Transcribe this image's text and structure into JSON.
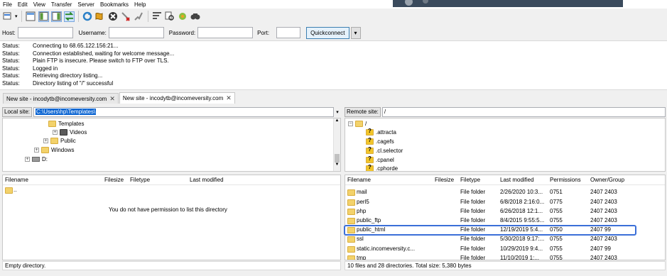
{
  "menu": [
    "File",
    "Edit",
    "View",
    "Transfer",
    "Server",
    "Bookmarks",
    "Help"
  ],
  "quickconnect": {
    "host_label": "Host:",
    "user_label": "Username:",
    "pass_label": "Password:",
    "port_label": "Port:",
    "button": "Quickconnect"
  },
  "log": [
    {
      "k": "Status:",
      "v": "Connecting to 68.65.122.156:21..."
    },
    {
      "k": "Status:",
      "v": "Connection established, waiting for welcome message..."
    },
    {
      "k": "Status:",
      "v": "Plain FTP is insecure. Please switch to FTP over TLS."
    },
    {
      "k": "Status:",
      "v": "Logged in"
    },
    {
      "k": "Status:",
      "v": "Retrieving directory listing..."
    },
    {
      "k": "Status:",
      "v": "Directory listing of \"/\" successful"
    }
  ],
  "tabs": [
    {
      "label": "New site - incodytb@incomeversity.com"
    },
    {
      "label": "New site - incodytb@incomeversity.com"
    }
  ],
  "local": {
    "label": "Local site:",
    "path": "C:\\Users\\hp\\Templates\\",
    "tree": [
      "Templates",
      "Videos",
      "Public",
      "Windows",
      "D:"
    ],
    "cols": [
      "Filename",
      "Filesize",
      "Filetype",
      "Last modified"
    ],
    "rows": [
      ".."
    ],
    "empty_msg": "You do not have permission to list this directory",
    "status": "Empty directory."
  },
  "remote": {
    "label": "Remote site:",
    "path": "/",
    "tree": [
      "/",
      ".attracta",
      ".cagefs",
      ".cl.selector",
      ".cpanel",
      ".cphorde"
    ],
    "cols": [
      "Filename",
      "Filesize",
      "Filetype",
      "Last modified",
      "Permissions",
      "Owner/Group"
    ],
    "rows": [
      {
        "name": "mail",
        "type": "File folder",
        "mod": "2/26/2020 10:3...",
        "perm": "0751",
        "owner": "2407 2403"
      },
      {
        "name": "perl5",
        "type": "File folder",
        "mod": "6/8/2018 2:16:0...",
        "perm": "0775",
        "owner": "2407 2403"
      },
      {
        "name": "php",
        "type": "File folder",
        "mod": "6/26/2018 12:1...",
        "perm": "0755",
        "owner": "2407 2403"
      },
      {
        "name": "public_ftp",
        "type": "File folder",
        "mod": "8/4/2015 9:55:5...",
        "perm": "0755",
        "owner": "2407 2403"
      },
      {
        "name": "public_html",
        "type": "File folder",
        "mod": "12/19/2019 5:4...",
        "perm": "0750",
        "owner": "2407 99"
      },
      {
        "name": "ssl",
        "type": "File folder",
        "mod": "5/30/2018 9:17:...",
        "perm": "0755",
        "owner": "2407 2403"
      },
      {
        "name": "static.incomeversity.c...",
        "type": "File folder",
        "mod": "10/29/2019 9:4...",
        "perm": "0755",
        "owner": "2407 99"
      },
      {
        "name": "tmp",
        "type": "File folder",
        "mod": "11/10/2019 1:...",
        "perm": "0755",
        "owner": "2407 2403"
      }
    ],
    "status": "10 files and 28 directories. Total size: 5,380 bytes"
  }
}
